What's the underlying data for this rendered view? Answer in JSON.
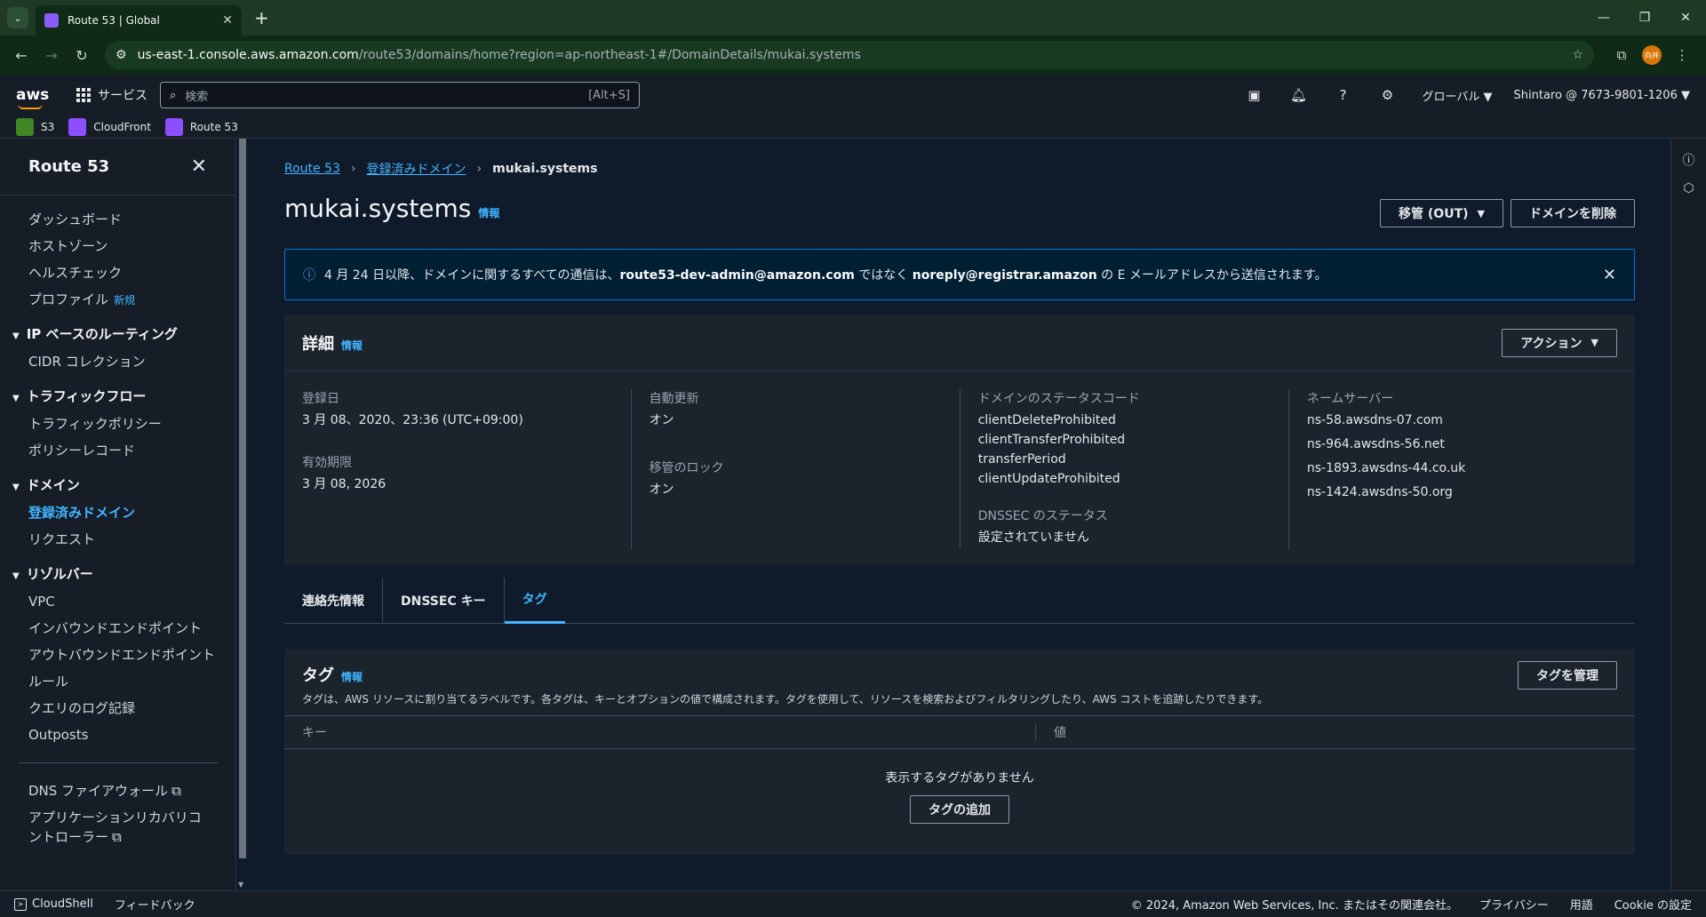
{
  "browser": {
    "tab_title": "Route 53 | Global",
    "url_host": "us-east-1.console.aws.amazon.com",
    "url_path": "/route53/domains/home?region=ap-northeast-1#/DomainDetails/mukai.systems",
    "profile_initials": "向井"
  },
  "awsnav": {
    "logo": "aws",
    "services_label": "サービス",
    "search_placeholder": "検索",
    "search_shortcut": "[Alt+S]",
    "region": "グローバル",
    "account": "Shintaro @ 7673-9801-1206"
  },
  "favorites": [
    {
      "label": "S3",
      "color": "#3f8624"
    },
    {
      "label": "CloudFront",
      "color": "#8c4fff"
    },
    {
      "label": "Route 53",
      "color": "#8c4fff"
    }
  ],
  "sidebar": {
    "title": "Route 53",
    "items_top": [
      "ダッシュボード",
      "ホストゾーン",
      "ヘルスチェック"
    ],
    "profile_label": "プロファイル",
    "new_badge": "新規",
    "sections": [
      {
        "title": "IP ベースのルーティング",
        "items": [
          "CIDR コレクション"
        ]
      },
      {
        "title": "トラフィックフロー",
        "items": [
          "トラフィックポリシー",
          "ポリシーレコード"
        ]
      },
      {
        "title": "ドメイン",
        "items": [
          "登録済みドメイン",
          "リクエスト"
        ]
      },
      {
        "title": "リゾルバー",
        "items": [
          "VPC",
          "インバウンドエンドポイント",
          "アウトバウンドエンドポイント",
          "ルール",
          "クエリのログ記録",
          "Outposts"
        ]
      }
    ],
    "external": [
      "DNS ファイアウォール",
      "アプリケーションリカバリコントローラー"
    ]
  },
  "breadcrumb": {
    "root": "Route 53",
    "parent": "登録済みドメイン",
    "current": "mukai.systems"
  },
  "page": {
    "title": "mukai.systems",
    "info": "情報",
    "transfer_btn": "移管 (OUT)",
    "delete_btn": "ドメインを削除"
  },
  "flash": {
    "pre": "4 月 24 日以降、ドメインに関するすべての通信は、",
    "old_email": "route53-dev-admin@amazon.com",
    "mid": " ではなく ",
    "new_email": "noreply@registrar.amazon",
    "post": " の E メールアドレスから送信されます。"
  },
  "details": {
    "title": "詳細",
    "action_btn": "アクション",
    "registered_label": "登録日",
    "registered_value": "3 月 08、2020、23:36 (UTC+09:00)",
    "expires_label": "有効期限",
    "expires_value": "3 月 08, 2026",
    "auto_renew_label": "自動更新",
    "auto_renew_value": "オン",
    "transfer_lock_label": "移管のロック",
    "transfer_lock_value": "オン",
    "status_label": "ドメインのステータスコード",
    "status_codes": [
      "clientDeleteProhibited",
      "clientTransferProhibited",
      "transferPeriod",
      "clientUpdateProhibited"
    ],
    "dnssec_label": "DNSSEC のステータス",
    "dnssec_value": "設定されていません",
    "ns_label": "ネームサーバー",
    "nameservers": [
      "ns-58.awsdns-07.com",
      "ns-964.awsdns-56.net",
      "ns-1893.awsdns-44.co.uk",
      "ns-1424.awsdns-50.org"
    ]
  },
  "tabs": [
    "連絡先情報",
    "DNSSEC キー",
    "タグ"
  ],
  "tags": {
    "title": "タグ",
    "manage_btn": "タグを管理",
    "description": "タグは、AWS リソースに割り当てるラベルです。各タグは、キーとオプションの値で構成されます。タグを使用して、リソースを検索およびフィルタリングしたり、AWS コストを追跡したりできます。",
    "col_key": "キー",
    "col_value": "値",
    "empty_text": "表示するタグがありません",
    "add_btn": "タグの追加"
  },
  "footer": {
    "cloudshell": "CloudShell",
    "feedback": "フィードバック",
    "copyright": "© 2024, Amazon Web Services, Inc. またはその関連会社。",
    "privacy": "プライバシー",
    "terms": "用語",
    "cookie": "Cookie の設定"
  }
}
